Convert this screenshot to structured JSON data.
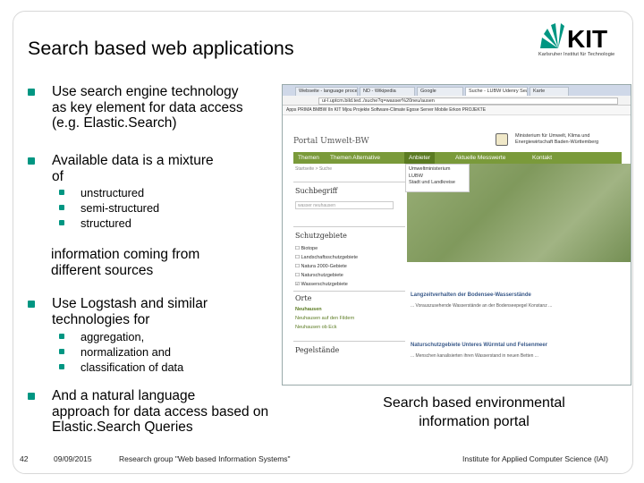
{
  "slide": {
    "title": "Search based web applications",
    "logo": {
      "mark": "KIT",
      "subtitle": "Karlsruher Institut für Technologie"
    },
    "bullets": [
      {
        "lines": [
          "Use search engine technology",
          "as key element for data access",
          "(e.g. Elastic.Search)"
        ]
      },
      {
        "lines": [
          "Available data is a mixture",
          "of"
        ],
        "sub": [
          "unstructured",
          "semi-structured",
          "structured"
        ]
      },
      {
        "lines": [
          "information coming from",
          "different sources"
        ]
      },
      {
        "lines": [
          "Use Logstash and similar",
          "technologies for"
        ],
        "sub": [
          "aggregation,",
          "normalization and",
          "classification of data"
        ]
      },
      {
        "lines": [
          "And a natural language",
          "approach for data access based on",
          "Elastic.Search Queries"
        ]
      }
    ],
    "caption": [
      "Search based environmental",
      "information portal"
    ],
    "footer": {
      "page": "42",
      "date": "09/09/2015",
      "group": "Research group \"Web based Information Systems\"",
      "institute": "Institute for Applied Computer Science (IAI)"
    },
    "accent_color": "#009682"
  },
  "screenshot": {
    "tabs": [
      "Webseite - language proces...",
      "ND - Wikipedia",
      "Google",
      "Suche - LUBW Udenry Search",
      "Karte"
    ],
    "address": "ui-l.uptcm.bild.ted../suche?q=wasser%20neu/ausen",
    "bookmarks": "Apps  PRIMA  BMBW  IIn  KIT  Mjou  Projekte  Software-Climate  Egose Server  Mobile  Erkon  PROJEKTE",
    "portal_title": "Portal Umwelt-BW",
    "ministry": "Ministerium für Umwelt, Klima und\nEnergiewirtschaft Baden-Württemberg",
    "nav": [
      "Themen",
      "Themen Alternative",
      "Anbieter",
      "Aktuelle Messwerte",
      "Kontakt"
    ],
    "crumb": "Startseite  > Suche",
    "dropdown": [
      "Umweltministerium",
      "LUBW",
      "Stadt und Landkreise"
    ],
    "search_heading": "Suchbegriff",
    "search_value": "wasser neuhausen",
    "schutz_heading": "Schutzgebiete",
    "schutz_items": [
      "Biotope",
      "Landschaftsschutzgebiete",
      "Natura 2000-Gebiete",
      "Naturschutzgebiete",
      "Wasserschutzgebiete"
    ],
    "orte_heading": "Orte",
    "orte_items": [
      "Neuhausen",
      "Neuhausen auf den Fildern",
      "Neuhausen ob Eck"
    ],
    "pegel_heading": "Pegelstände",
    "results": [
      {
        "title": "Langzeitverhalten der Bodensee-Wasserstände",
        "text": "... Vorauszusehende Wasserstände an der Bodenseepegel Konstanz ..."
      },
      {
        "title": "Naturschutzgebiete Unteres Würmtal und Felsenmeer",
        "text": "... Menschen kanalisierten ihren Wasserstand in neuen Betten ..."
      }
    ]
  }
}
